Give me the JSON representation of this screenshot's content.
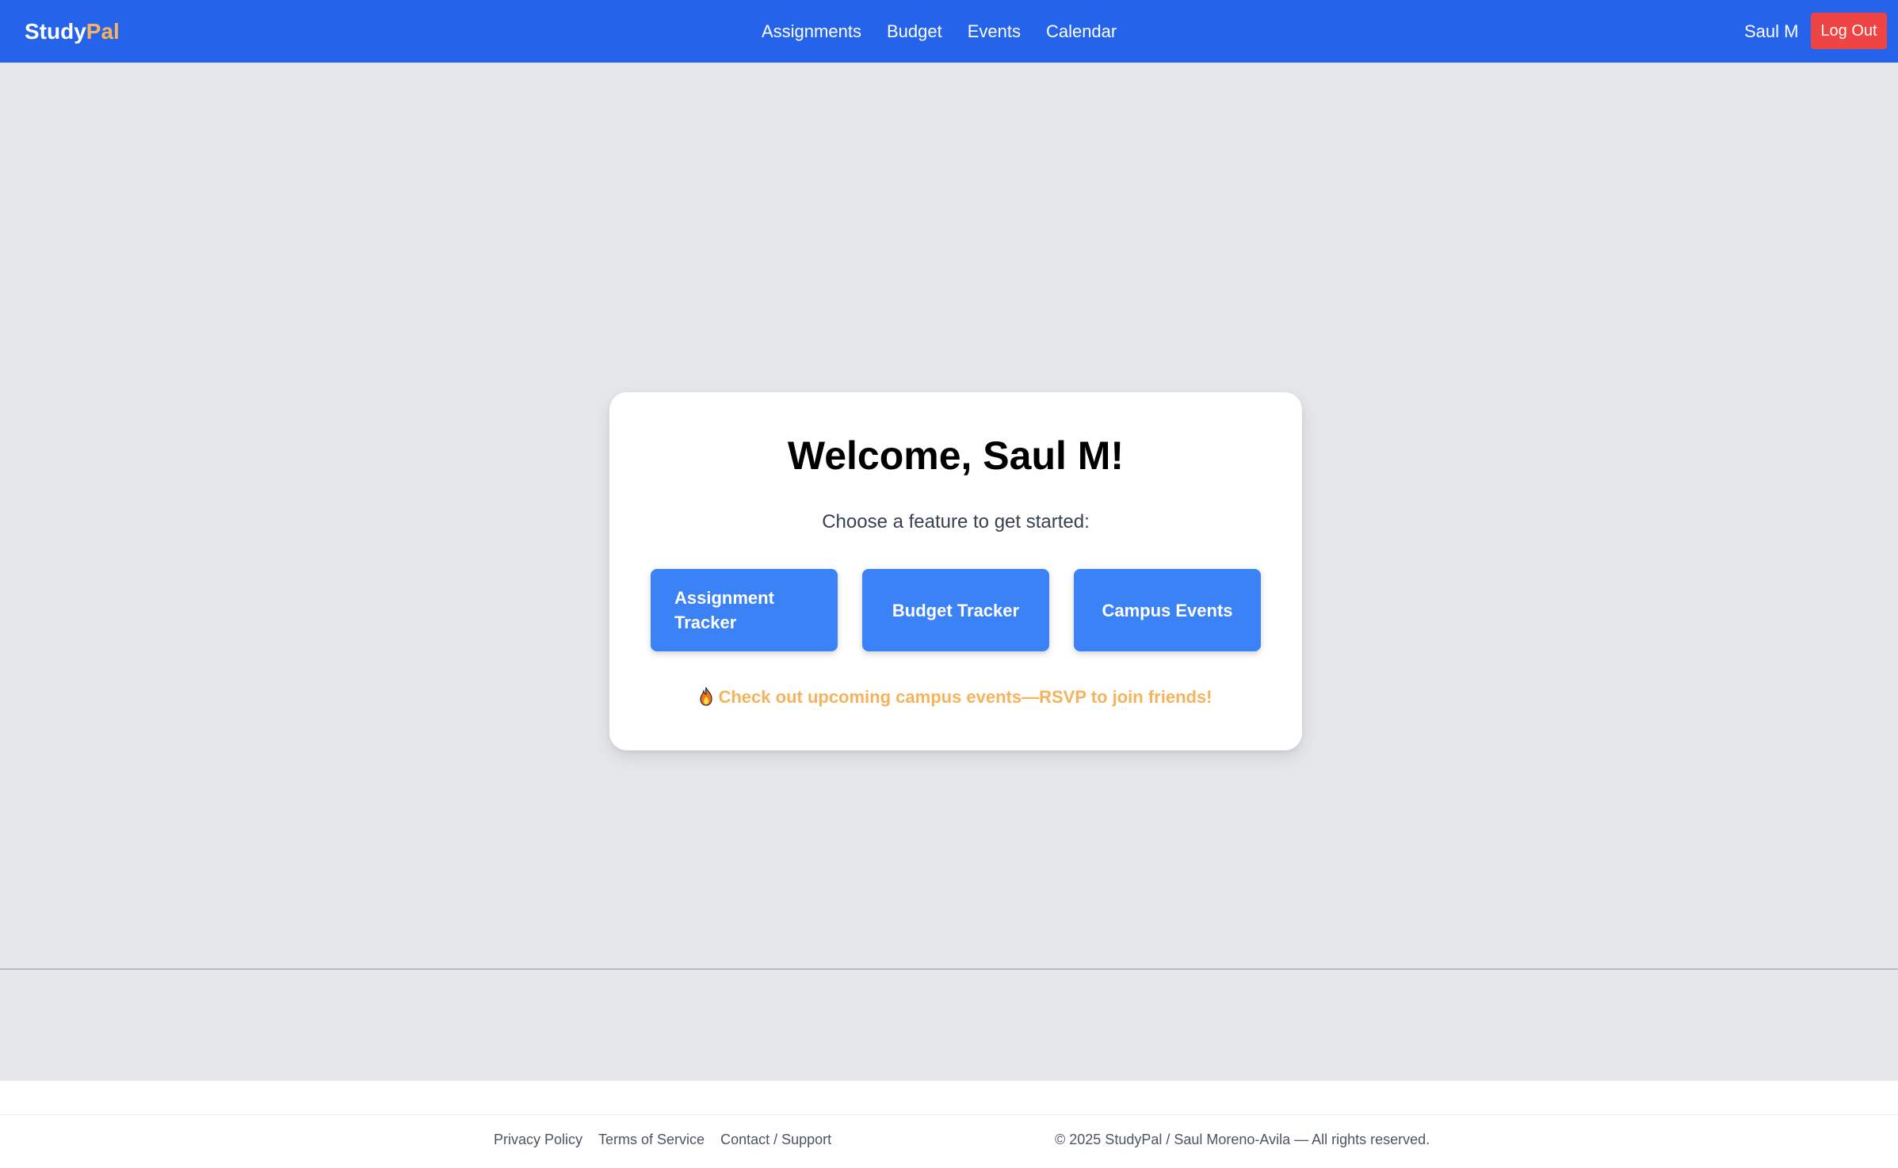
{
  "header": {
    "logo_main": "Study",
    "logo_accent": "Pal",
    "nav": [
      "Assignments",
      "Budget",
      "Events",
      "Calendar"
    ],
    "user_name": "Saul M",
    "logout_label": "Log Out"
  },
  "main": {
    "welcome": "Welcome, Saul M!",
    "subtitle": "Choose a feature to get started:",
    "features": [
      "Assignment Tracker",
      "Budget Tracker",
      "Campus Events"
    ],
    "tip_icon": "fire-icon",
    "tip_text": "Check out upcoming campus events—RSVP to join friends!"
  },
  "footer": {
    "links": [
      "Privacy Policy",
      "Terms of Service",
      "Contact / Support"
    ],
    "copyright": "© 2025 StudyPal / Saul Moreno-Avila — All rights reserved."
  },
  "colors": {
    "header_bg": "#2563eb",
    "logo_accent": "#f6b35c",
    "logout_bg": "#ef4444",
    "feature_button_bg": "#3b82f6",
    "tip_text": "#f6b35c",
    "page_bg": "#e5e7eb"
  }
}
